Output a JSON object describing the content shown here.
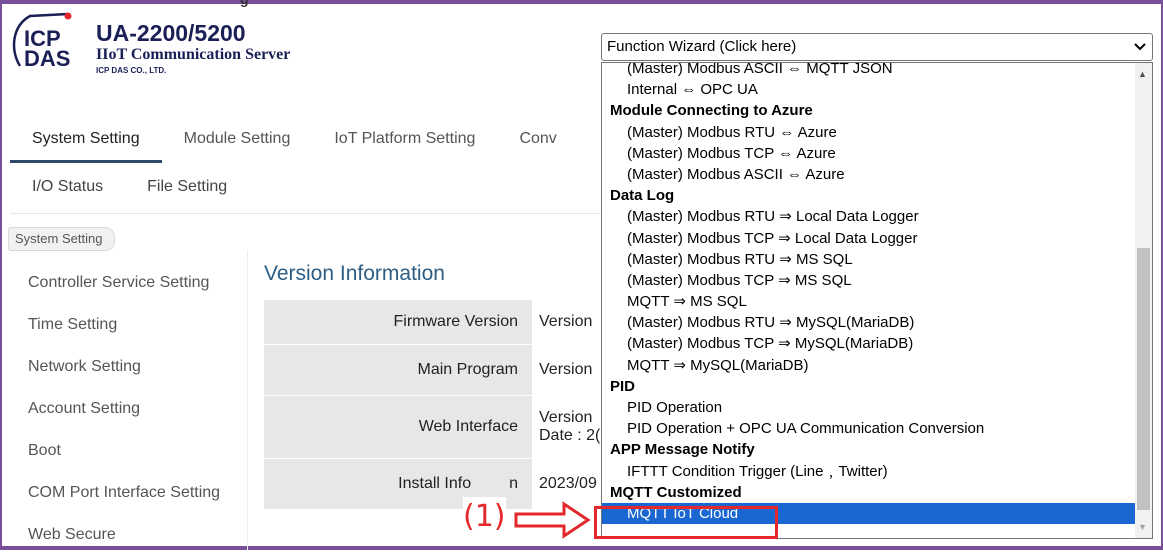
{
  "brand": {
    "logo_text_top": "ICP",
    "logo_text_bottom": "DAS",
    "title": "UA-2200/5200",
    "subtitle": "IIoT Communication Server",
    "company": "ICP DAS CO., LTD.",
    "logo_color": "#1a1f56",
    "accent_color": "#e5282c"
  },
  "page_header_peek": "g",
  "tabs": [
    {
      "label": "System Setting",
      "active": true
    },
    {
      "label": "Module Setting"
    },
    {
      "label": "IoT Platform Setting"
    },
    {
      "label": "Conv"
    }
  ],
  "subtabs": [
    {
      "label": "I/O Status"
    },
    {
      "label": "File Setting"
    }
  ],
  "breadcrumb": "System Setting",
  "sidebar": {
    "items": [
      {
        "label": "Controller Service Setting"
      },
      {
        "label": "Time Setting"
      },
      {
        "label": "Network Setting"
      },
      {
        "label": "Account Setting"
      },
      {
        "label": "Boot"
      },
      {
        "label": "COM Port Interface Setting"
      },
      {
        "label": "Web Secure"
      }
    ]
  },
  "main": {
    "title": "Version Information",
    "rows": [
      {
        "label": "Firmware Version",
        "value": "Version"
      },
      {
        "label": "Main Program",
        "value": "Version"
      },
      {
        "label": "Web Interface",
        "value": "Version",
        "value2": "Date : 2("
      },
      {
        "label": "Install Info",
        "label_tail": "n",
        "value": "2023/09"
      }
    ]
  },
  "function_wizard": {
    "selected_label": "Function Wizard  (Click here)",
    "dropdown": [
      {
        "type": "opt",
        "label": "(Master) Modbus ASCII ⇔ MQTT JSON"
      },
      {
        "type": "opt",
        "label": "Internal ⇔ OPC UA"
      },
      {
        "type": "group",
        "label": "Module Connecting to Azure"
      },
      {
        "type": "opt",
        "label": "(Master) Modbus RTU ⇔ Azure"
      },
      {
        "type": "opt",
        "label": "(Master) Modbus TCP ⇔ Azure"
      },
      {
        "type": "opt",
        "label": "(Master) Modbus ASCII ⇔ Azure"
      },
      {
        "type": "group",
        "label": "Data Log"
      },
      {
        "type": "opt",
        "label": "(Master) Modbus RTU ⇒ Local Data Logger"
      },
      {
        "type": "opt",
        "label": "(Master) Modbus TCP ⇒ Local Data Logger"
      },
      {
        "type": "opt",
        "label": "(Master) Modbus RTU ⇒ MS SQL"
      },
      {
        "type": "opt",
        "label": "(Master) Modbus TCP ⇒ MS SQL"
      },
      {
        "type": "opt",
        "label": "MQTT ⇒ MS SQL"
      },
      {
        "type": "opt",
        "label": "(Master) Modbus RTU ⇒ MySQL(MariaDB)"
      },
      {
        "type": "opt",
        "label": "(Master) Modbus TCP ⇒ MySQL(MariaDB)"
      },
      {
        "type": "opt",
        "label": "MQTT ⇒ MySQL(MariaDB)"
      },
      {
        "type": "group",
        "label": "PID"
      },
      {
        "type": "opt",
        "label": "PID Operation"
      },
      {
        "type": "opt",
        "label": "PID Operation + OPC UA Communication Conversion"
      },
      {
        "type": "group",
        "label": "APP Message Notify"
      },
      {
        "type": "opt",
        "label": "IFTTT Condition Trigger (Line﹐Twitter)"
      },
      {
        "type": "group",
        "label": "MQTT  Customized"
      },
      {
        "type": "opt",
        "label": "MQTT IoT Cloud",
        "selected": true
      }
    ]
  },
  "annotation": {
    "step_label": "(1)"
  }
}
